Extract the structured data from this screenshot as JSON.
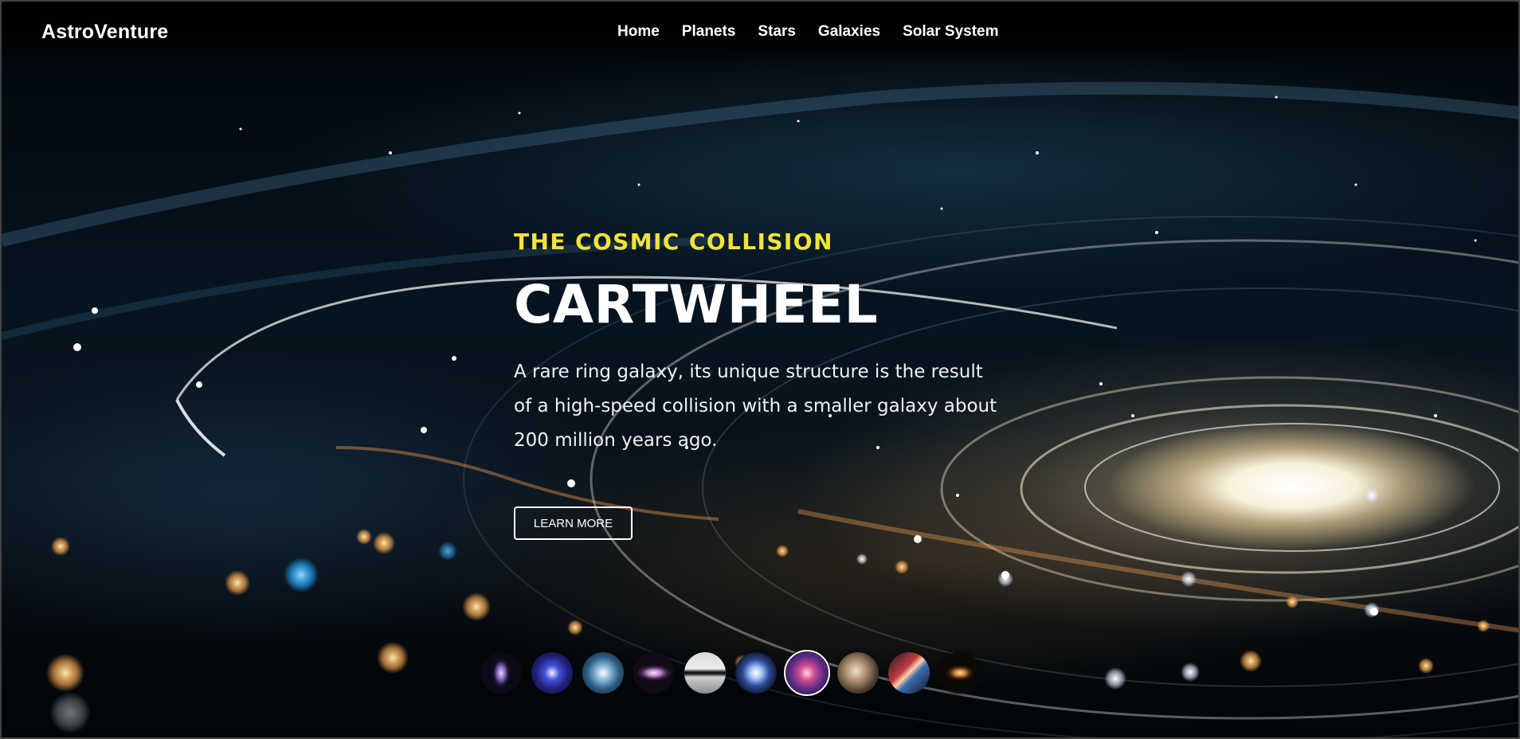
{
  "brand": {
    "name": "AstroVenture"
  },
  "nav": {
    "items": [
      {
        "label": "Home"
      },
      {
        "label": "Planets"
      },
      {
        "label": "Stars"
      },
      {
        "label": "Galaxies"
      },
      {
        "label": "Solar System"
      }
    ]
  },
  "hero": {
    "eyebrow": "THE COSMIC COLLISION",
    "title": "CARTWHEEL",
    "description": "A rare ring galaxy, its unique structure is the result of a high-speed collision with a smaller galaxy about 200 million years ago.",
    "button_label": "LEARN MORE"
  },
  "carousel": {
    "items": [
      {
        "icon": "spiral-galaxy-thumbnail"
      },
      {
        "icon": "blue-galaxy-thumbnail"
      },
      {
        "icon": "starburst-galaxy-thumbnail"
      },
      {
        "icon": "purple-galaxy-thumbnail"
      },
      {
        "icon": "edge-on-galaxy-thumbnail"
      },
      {
        "icon": "spiral-galaxy-thumbnail"
      },
      {
        "icon": "cartwheel-galaxy-thumbnail",
        "active": true
      },
      {
        "icon": "elliptical-galaxy-thumbnail"
      },
      {
        "icon": "red-galaxy-thumbnail"
      },
      {
        "icon": "sombrero-galaxy-thumbnail"
      }
    ]
  },
  "colors": {
    "accent": "#f2e339",
    "text": "#ffffff",
    "background": "#061420"
  }
}
